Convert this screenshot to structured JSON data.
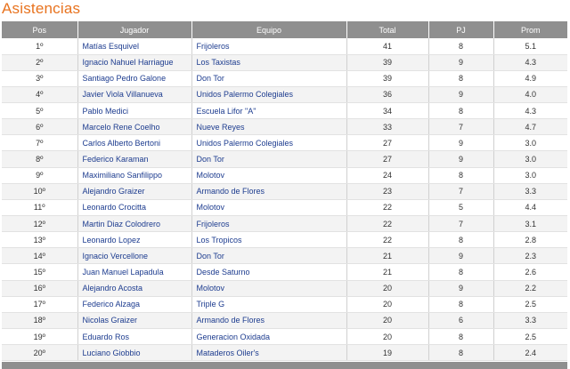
{
  "title": "Asistencias",
  "columns": [
    "Pos",
    "Jugador",
    "Equipo",
    "Total",
    "PJ",
    "Prom"
  ],
  "rows": [
    {
      "pos": "1º",
      "jugador": "Matías Esquivel",
      "equipo": "Frijoleros",
      "total": "41",
      "pj": "8",
      "prom": "5.1"
    },
    {
      "pos": "2º",
      "jugador": "Ignacio Nahuel Harriague",
      "equipo": "Los Taxistas",
      "total": "39",
      "pj": "9",
      "prom": "4.3"
    },
    {
      "pos": "3º",
      "jugador": "Santiago Pedro Galone",
      "equipo": "Don Tor",
      "total": "39",
      "pj": "8",
      "prom": "4.9"
    },
    {
      "pos": "4º",
      "jugador": "Javier Viola Villanueva",
      "equipo": "Unidos Palermo Colegiales",
      "total": "36",
      "pj": "9",
      "prom": "4.0"
    },
    {
      "pos": "5º",
      "jugador": "Pablo Medici",
      "equipo": "Escuela Lifor \"A\"",
      "total": "34",
      "pj": "8",
      "prom": "4.3"
    },
    {
      "pos": "6º",
      "jugador": "Marcelo Rene Coelho",
      "equipo": "Nueve Reyes",
      "total": "33",
      "pj": "7",
      "prom": "4.7"
    },
    {
      "pos": "7º",
      "jugador": "Carlos Alberto Bertoni",
      "equipo": "Unidos Palermo Colegiales",
      "total": "27",
      "pj": "9",
      "prom": "3.0"
    },
    {
      "pos": "8º",
      "jugador": "Federico Karaman",
      "equipo": "Don Tor",
      "total": "27",
      "pj": "9",
      "prom": "3.0"
    },
    {
      "pos": "9º",
      "jugador": "Maximiliano Sanfilippo",
      "equipo": "Molotov",
      "total": "24",
      "pj": "8",
      "prom": "3.0"
    },
    {
      "pos": "10º",
      "jugador": "Alejandro Graizer",
      "equipo": "Armando de Flores",
      "total": "23",
      "pj": "7",
      "prom": "3.3"
    },
    {
      "pos": "11º",
      "jugador": "Leonardo Crocitta",
      "equipo": "Molotov",
      "total": "22",
      "pj": "5",
      "prom": "4.4"
    },
    {
      "pos": "12º",
      "jugador": "Martin Diaz Colodrero",
      "equipo": "Frijoleros",
      "total": "22",
      "pj": "7",
      "prom": "3.1"
    },
    {
      "pos": "13º",
      "jugador": "Leonardo Lopez",
      "equipo": "Los Tropicos",
      "total": "22",
      "pj": "8",
      "prom": "2.8"
    },
    {
      "pos": "14º",
      "jugador": "Ignacio Vercellone",
      "equipo": "Don Tor",
      "total": "21",
      "pj": "9",
      "prom": "2.3"
    },
    {
      "pos": "15º",
      "jugador": "Juan Manuel Lapadula",
      "equipo": "Desde Saturno",
      "total": "21",
      "pj": "8",
      "prom": "2.6"
    },
    {
      "pos": "16º",
      "jugador": "Alejandro Acosta",
      "equipo": "Molotov",
      "total": "20",
      "pj": "9",
      "prom": "2.2"
    },
    {
      "pos": "17º",
      "jugador": "Federico Alzaga",
      "equipo": "Triple G",
      "total": "20",
      "pj": "8",
      "prom": "2.5"
    },
    {
      "pos": "18º",
      "jugador": "Nicolas Graizer",
      "equipo": "Armando de Flores",
      "total": "20",
      "pj": "6",
      "prom": "3.3"
    },
    {
      "pos": "19º",
      "jugador": "Eduardo Ros",
      "equipo": "Generacion Oxidada",
      "total": "20",
      "pj": "8",
      "prom": "2.5"
    },
    {
      "pos": "20º",
      "jugador": "Luciano Giobbio",
      "equipo": "Mataderos Oiler's",
      "total": "19",
      "pj": "8",
      "prom": "2.4"
    }
  ]
}
